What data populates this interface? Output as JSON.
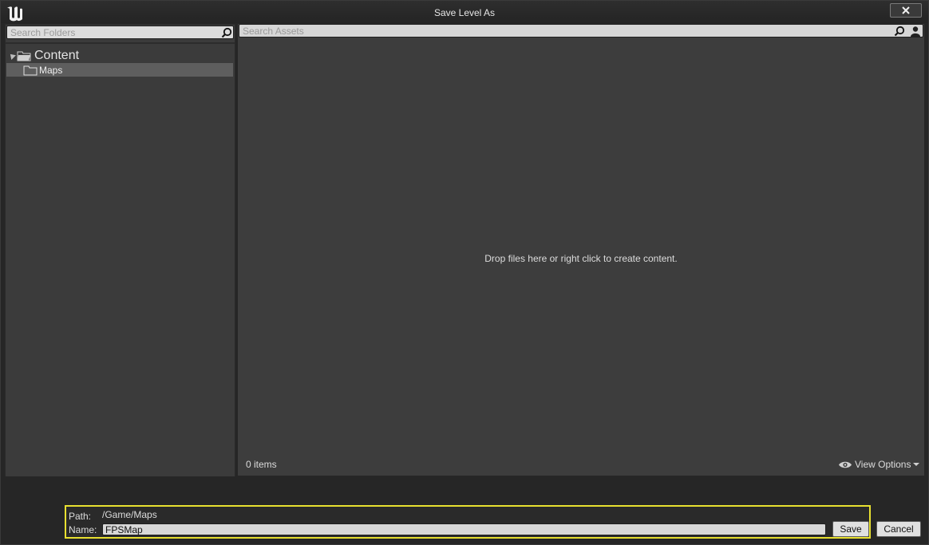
{
  "window": {
    "title": "Save Level As",
    "logo_icon": "unreal-engine-logo-icon",
    "close_icon": "close-icon"
  },
  "folders": {
    "search_placeholder": "Search Folders",
    "tree": [
      {
        "label": "Content",
        "icon": "folder-open-icon",
        "expanded": true
      },
      {
        "label": "Maps",
        "icon": "folder-icon",
        "selected": true
      }
    ]
  },
  "assets": {
    "search_placeholder": "Search Assets",
    "empty_message": "Drop files here or right click to create content.",
    "item_count": "0 items",
    "view_options_label": "View Options"
  },
  "save_form": {
    "path_label": "Path:",
    "path_value": "/Game/Maps",
    "name_label": "Name:",
    "name_value": "FPSMap",
    "save_label": "Save",
    "cancel_label": "Cancel"
  },
  "colors": {
    "highlight_border": "#e8e030",
    "panel_bg": "#3d3d3d",
    "window_bg": "#262626"
  }
}
